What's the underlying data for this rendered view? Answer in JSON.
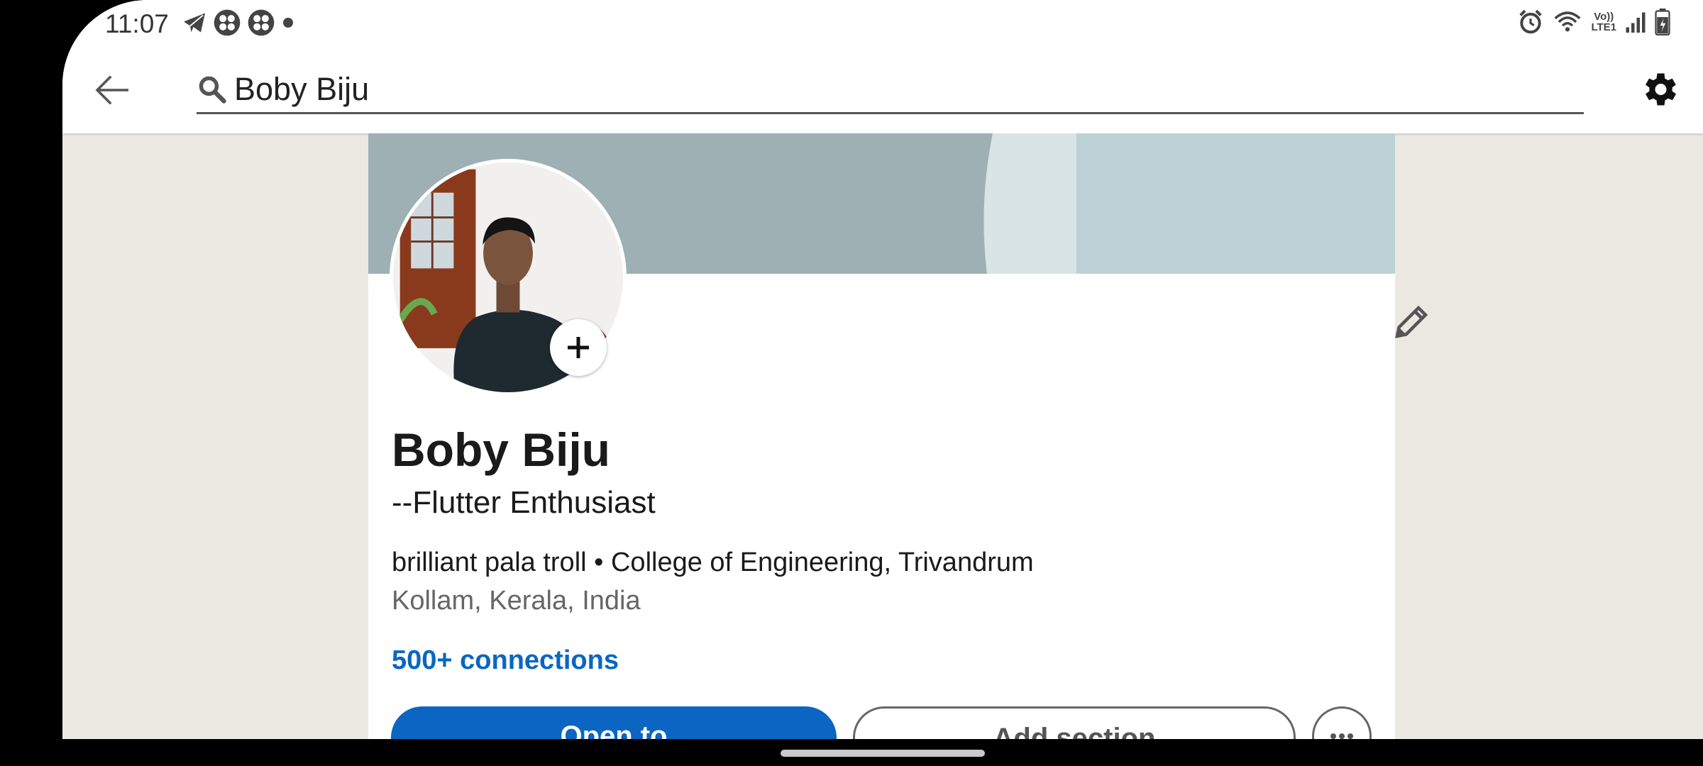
{
  "status_bar": {
    "time": "11:07",
    "left_icons": [
      "telegram-icon",
      "app-grid-icon",
      "app-grid-icon",
      "dot-icon"
    ],
    "right_icons": [
      "alarm-icon",
      "wifi-icon",
      "volte-icon",
      "signal-icon",
      "battery-icon"
    ],
    "volte_top": "Vo))",
    "volte_bottom": "LTE1"
  },
  "app_bar": {
    "back_icon": "arrow-left-icon",
    "search_icon": "search-icon",
    "search_query": "Boby Biju",
    "settings_icon": "gear-icon"
  },
  "profile": {
    "name": "Boby Biju",
    "headline": "--Flutter Enthusiast",
    "meta": "brilliant pala troll • College of Engineering, Trivandrum",
    "location": "Kollam, Kerala, India",
    "connections": "500+ connections",
    "add_photo_icon": "plus-icon",
    "edit_icon": "pencil-icon"
  },
  "actions": {
    "open_to": "Open to",
    "add_section": "Add section",
    "more_icon": "more-horizontal-icon"
  },
  "colors": {
    "brand_blue": "#0a66c2",
    "background": "#ebe8e2",
    "banner_left": "#9eb0b4",
    "banner_right": "#bcd1d6"
  }
}
